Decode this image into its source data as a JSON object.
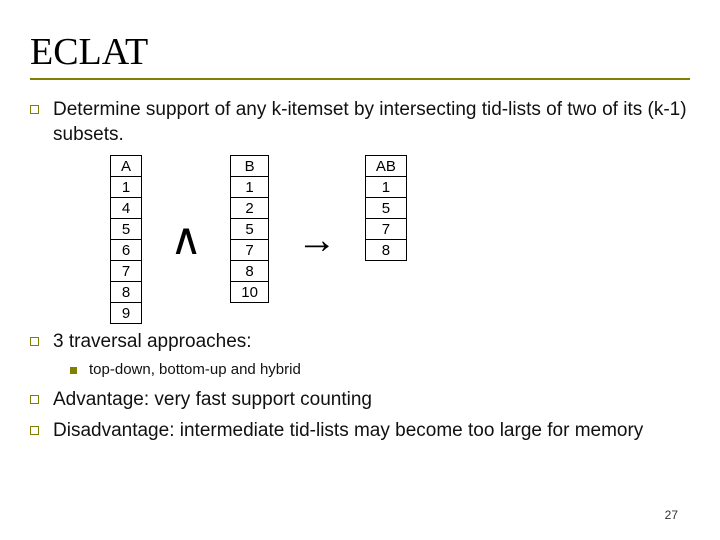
{
  "title": "ECLAT",
  "bullets": {
    "b1": "Determine support of any k-itemset by intersecting tid-lists of two of its (k-1) subsets.",
    "b2": "3 traversal approaches:",
    "b2_sub": "top-down, bottom-up and hybrid",
    "b3": "Advantage: very fast support counting",
    "b4": "Disadvantage: intermediate tid-lists may become too large for memory"
  },
  "tables": {
    "A": {
      "header": "A",
      "rows": [
        "1",
        "4",
        "5",
        "6",
        "7",
        "8",
        "9"
      ]
    },
    "B": {
      "header": "B",
      "rows": [
        "1",
        "2",
        "5",
        "7",
        "8",
        "10"
      ]
    },
    "AB": {
      "header": "AB",
      "rows": [
        "1",
        "5",
        "7",
        "8"
      ]
    }
  },
  "operators": {
    "intersect": "∧",
    "arrow": "→"
  },
  "page_number": "27"
}
